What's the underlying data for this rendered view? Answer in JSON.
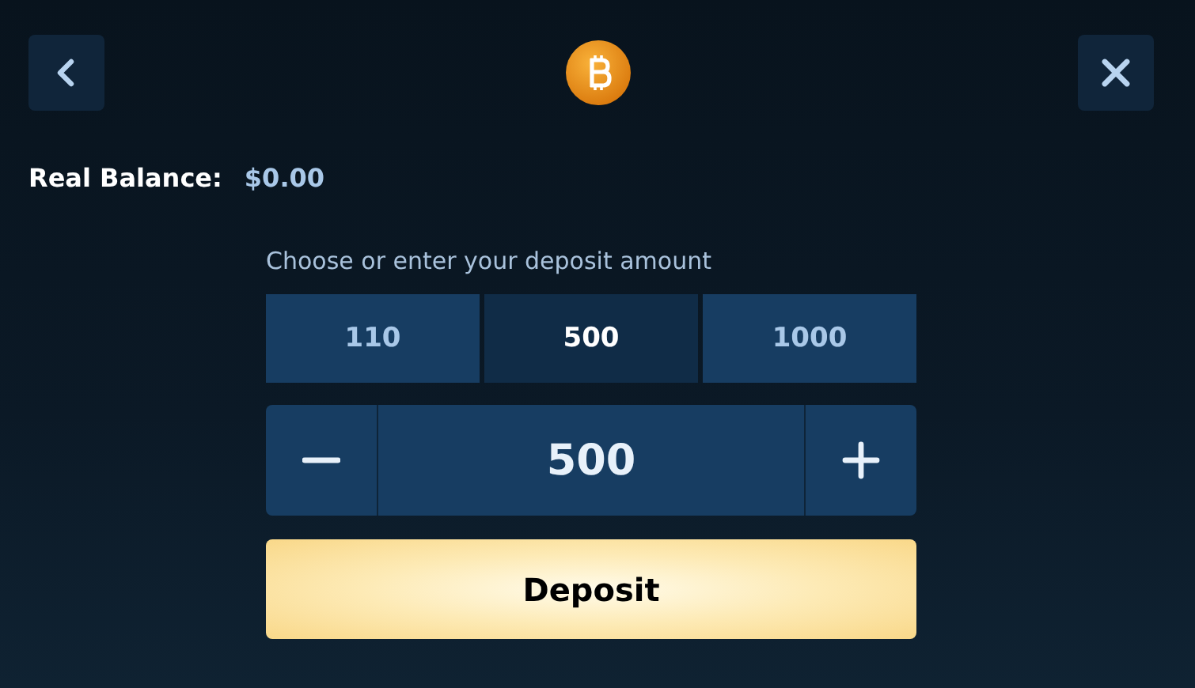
{
  "balance": {
    "label": "Real Balance:",
    "value": "$0.00"
  },
  "prompt": "Choose or enter your deposit amount",
  "amounts": [
    {
      "label": "110",
      "selected": false
    },
    {
      "label": "500",
      "selected": true
    },
    {
      "label": "1000",
      "selected": false
    }
  ],
  "amount_field": {
    "value": "500"
  },
  "deposit_button": "Deposit"
}
